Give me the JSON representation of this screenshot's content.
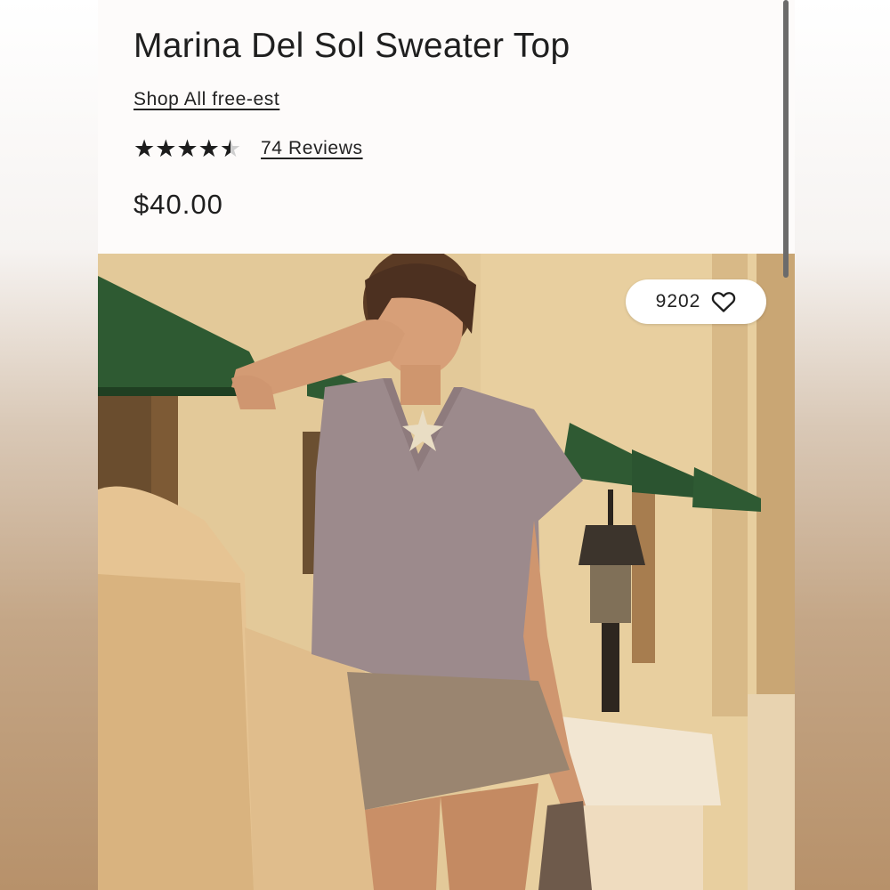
{
  "product": {
    "title": "Marina Del Sol Sweater Top",
    "shop_all_link": "Shop All free-est",
    "rating": {
      "value": 4.5,
      "max": 5,
      "reviews_label": "74 Reviews"
    },
    "price": "$40.00"
  },
  "hero": {
    "image_description": "model wearing mauve v-neck sweater top with starfish necklace and tan mini skirt, yellow building with green awnings and street lamp",
    "likes": {
      "count": "9202",
      "icon": "heart-outline-icon"
    }
  },
  "colors": {
    "text": "#1f1f1f",
    "awning_green": "#2e5a32",
    "wall_yellow": "#e6cd9b",
    "top_mauve": "#9c8a8c",
    "skirt_tan": "#9a8570"
  }
}
